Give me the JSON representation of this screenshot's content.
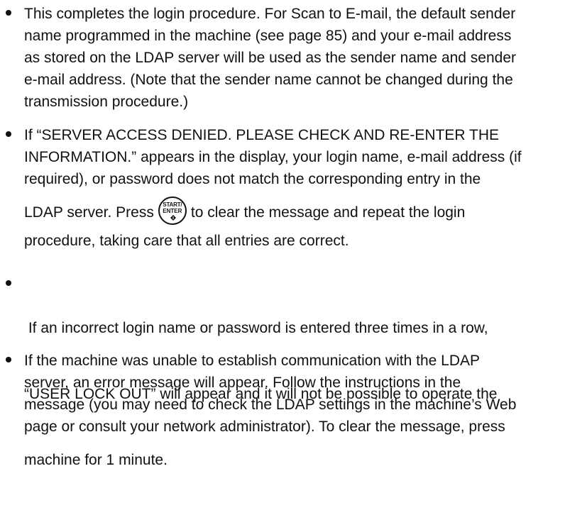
{
  "items": [
    {
      "lines": [
        "This completes the login procedure. For Scan to E-mail, the default sender",
        "name programmed in the machine (see page 85) and your e-mail address",
        "as stored on the LDAP server will be used as the sender name and sender",
        "e-mail address. (Note that the sender name cannot be changed during the",
        "transmission procedure.)"
      ]
    },
    {
      "lines": [
        "If “SERVER ACCESS DENIED. PLEASE CHECK AND RE-ENTER THE",
        "INFORMATION.” appears in the display, your login name, e-mail address (if",
        "required), or password does not match the corresponding entry in the"
      ],
      "press_before": "LDAP server. Press",
      "press_after": "to clear the message and repeat the login",
      "last_line": "procedure, taking care that all entries are correct."
    },
    {
      "lines": [
        " If an incorrect login name or password is entered three times in a row,",
        "“USER LOCK OUT” will appear and it will not be possible to operate the",
        "machine for 1 minute."
      ]
    },
    {
      "lines": [
        "If the machine was unable to establish communication with the LDAP",
        "server, an error message will appear. Follow the instructions in the",
        "message (you may need to check the LDAP settings in the machine’s Web",
        "page or consult your network administrator). To clear the message, press"
      ]
    }
  ],
  "start_key": {
    "top_label": "START/",
    "bottom_label": "ENTER",
    "icon": "start-diamond-icon"
  }
}
